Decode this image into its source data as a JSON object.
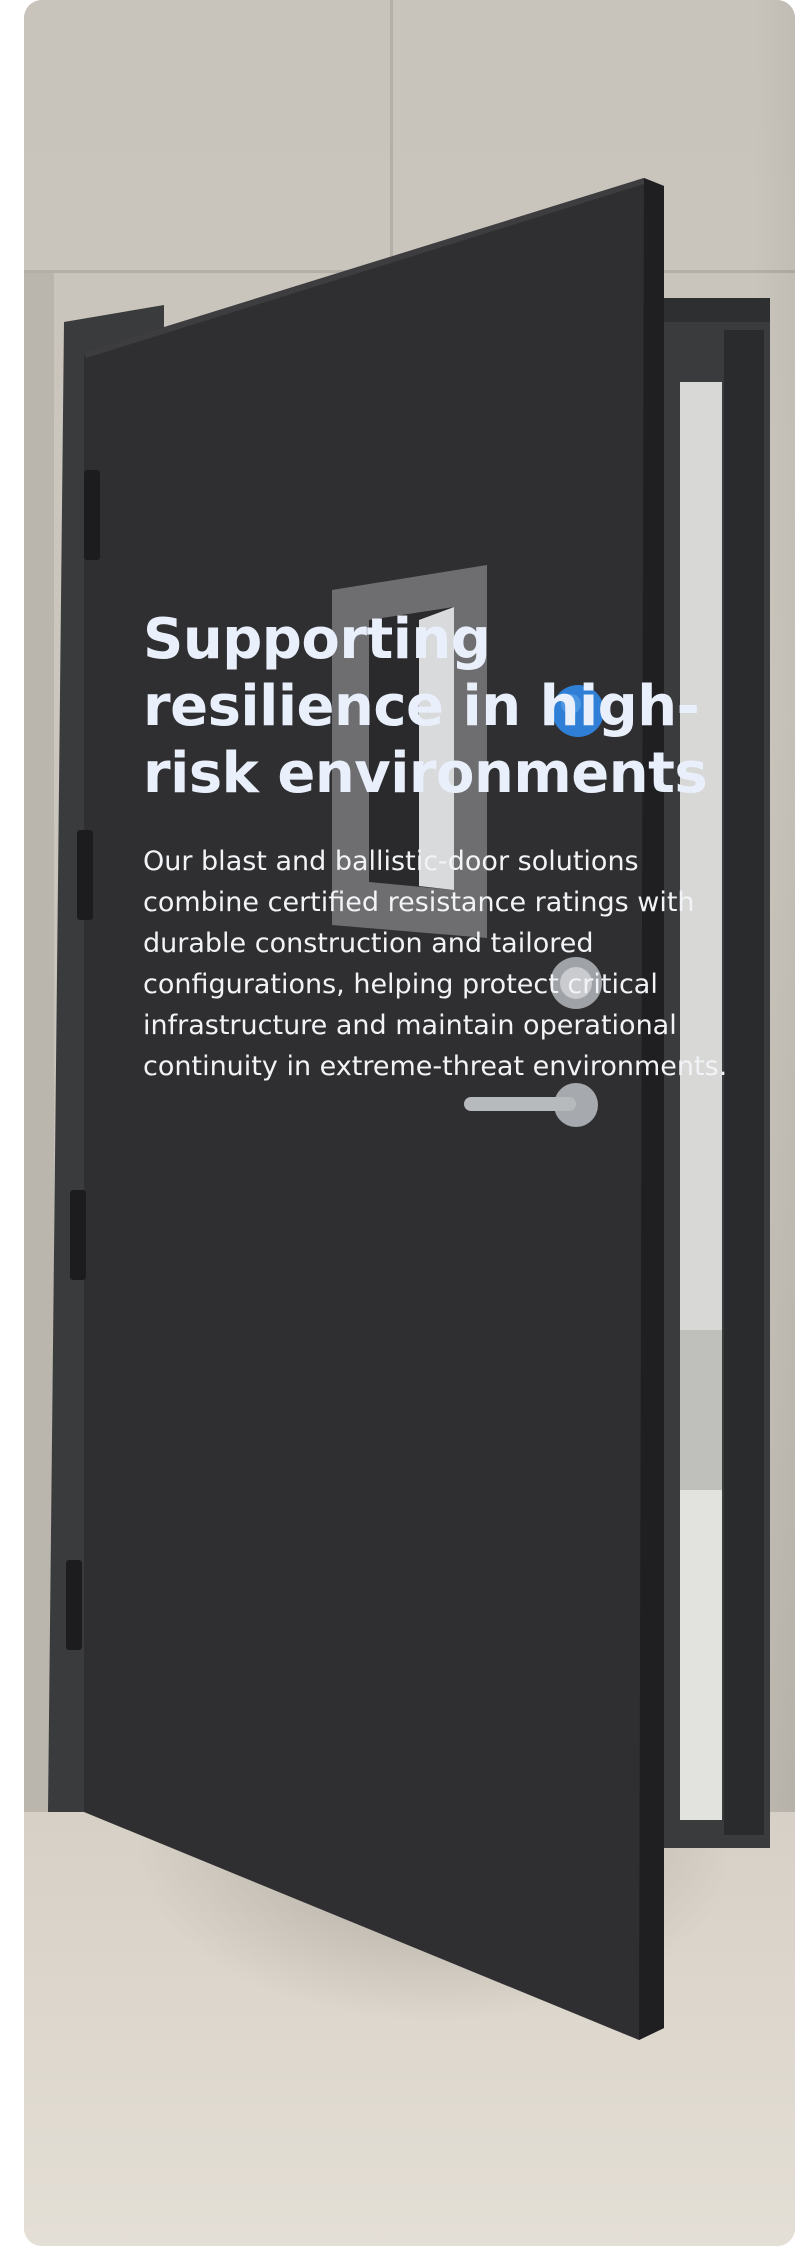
{
  "hero": {
    "headline": "Supporting resilience in high-risk environments",
    "description": "Our blast and ballistic-door solutions combine certified resistance ratings with durable construction and tailored configurations, helping protect critical infrastructure and maintain operational continuity in extreme-threat environments."
  },
  "colors": {
    "door": "#2f2f31",
    "frame": "#3a3b3d",
    "wall": "#c8c3bb",
    "floor": "#ddd7cd",
    "headline_text": "#e9f0fb",
    "body_text": "#f1f3f6",
    "accent_dot": "#2f7fd6"
  },
  "icons": [
    "door-hinge-icon",
    "lever-handle-icon",
    "lock-cylinder-icon"
  ]
}
